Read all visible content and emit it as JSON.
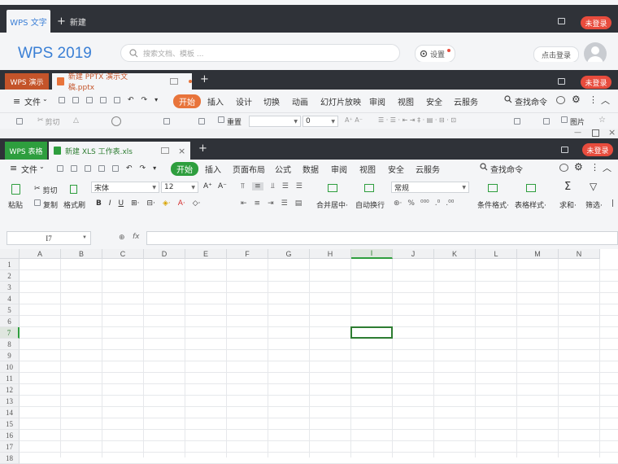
{
  "writer": {
    "app_tab": "WPS 文字",
    "new_tab": "新建",
    "login": "未登录",
    "brand": "WPS 2019",
    "search_placeholder": "搜索文档、模板 ...",
    "settings": "设置",
    "login_link": "点击登录"
  },
  "presentation": {
    "app_tab": "WPS 演示",
    "doc_tab": "新建 PPTX 演示文稿.pptx",
    "login": "未登录",
    "menu_file": "文件",
    "start": "开始",
    "tabs": [
      "插入",
      "设计",
      "切换",
      "动画",
      "幻灯片放映",
      "审阅",
      "视图",
      "安全",
      "云服务"
    ],
    "search_cmd": "查找命令",
    "cut": "剪切",
    "reset": "重置",
    "font_size": "0",
    "picture": "图片"
  },
  "spreadsheet": {
    "app_tab": "WPS 表格",
    "doc_tab": "新建 XLS 工作表.xls",
    "login": "未登录",
    "menu_file": "文件",
    "start": "开始",
    "tabs": [
      "插入",
      "页面布局",
      "公式",
      "数据",
      "审阅",
      "视图",
      "安全",
      "云服务"
    ],
    "search_cmd": "查找命令",
    "paste": "粘贴",
    "cut": "剪切",
    "copy": "复制",
    "format_painter": "格式刷",
    "font_name": "宋体",
    "font_size": "12",
    "merge_center": "合并居中",
    "wrap_text": "自动换行",
    "number_format": "常规",
    "conditional_format": "条件格式",
    "table_style": "表格样式",
    "sum": "求和",
    "filter": "筛选",
    "name_box": "I7",
    "fx": "fx",
    "columns": [
      "A",
      "B",
      "C",
      "D",
      "E",
      "F",
      "G",
      "H",
      "I",
      "J",
      "K",
      "L",
      "M",
      "N"
    ],
    "rows": [
      "1",
      "2",
      "3",
      "4",
      "5",
      "6",
      "7",
      "8",
      "9",
      "10",
      "11",
      "12",
      "13",
      "14",
      "15",
      "16",
      "17",
      "18"
    ],
    "active_column": "I",
    "active_row": "7"
  },
  "colors": {
    "titlebar": "#2f3238",
    "writer_accent": "#3a7fd5",
    "presentation_accent": "#c4542a",
    "spreadsheet_accent": "#2e9e3e",
    "login_red": "#e84c3d"
  }
}
